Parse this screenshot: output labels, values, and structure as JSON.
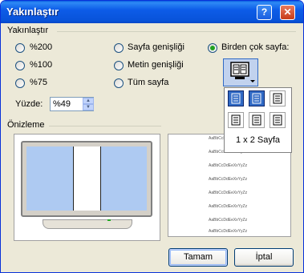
{
  "window": {
    "title": "Yakınlaştır"
  },
  "zoom_group": {
    "label": "Yakınlaştır",
    "options": [
      {
        "label": "%200",
        "selected": false
      },
      {
        "label": "%100",
        "selected": false
      },
      {
        "label": "%75",
        "selected": false
      },
      {
        "label": "Sayfa genişliği",
        "selected": false
      },
      {
        "label": "Metin genişliği",
        "selected": false
      },
      {
        "label": "Tüm sayfa",
        "selected": false
      },
      {
        "label": "Birden çok sayfa:",
        "selected": true
      }
    ],
    "percent_label": "Yüzde:",
    "percent_value": "%49"
  },
  "preview": {
    "label": "Önizleme",
    "sample_text": "AaBbCcDdEeXxYyZz",
    "sample_lines": [
      "AaBbCcDdEeXxYyZz",
      "AaBbCcDdEeXxYyZz",
      "AaBbCcDdEeXxYyZz",
      "AaBbCcDdEeXxYyZz",
      "AaBbCcDdEeXxYyZz",
      "AaBbCcDdEeXxYyZz",
      "AaBbCcDdEeXxYyZz",
      "AaBbCcDdEeXxYyZz"
    ]
  },
  "multi_page_picker": {
    "selection_label": "1 x 2 Sayfa",
    "selected_rows": 1,
    "selected_cols": 2
  },
  "buttons": {
    "ok": "Tamam",
    "cancel": "İptal"
  },
  "colors": {
    "title_bar": "#0a5de0",
    "selection": "#316ac5",
    "screen": "#aecaf2"
  }
}
